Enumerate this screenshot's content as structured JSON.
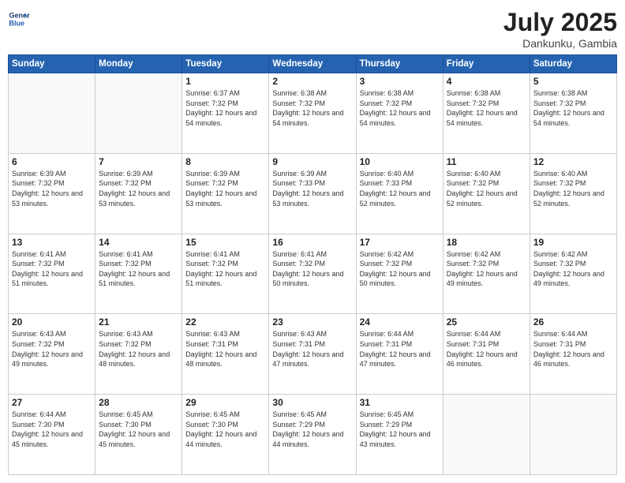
{
  "header": {
    "logo_general": "General",
    "logo_blue": "Blue",
    "month_year": "July 2025",
    "location": "Dankunku, Gambia"
  },
  "days_of_week": [
    "Sunday",
    "Monday",
    "Tuesday",
    "Wednesday",
    "Thursday",
    "Friday",
    "Saturday"
  ],
  "weeks": [
    [
      {
        "day": "",
        "sunrise": "",
        "sunset": "",
        "daylight": ""
      },
      {
        "day": "",
        "sunrise": "",
        "sunset": "",
        "daylight": ""
      },
      {
        "day": "1",
        "sunrise": "Sunrise: 6:37 AM",
        "sunset": "Sunset: 7:32 PM",
        "daylight": "Daylight: 12 hours and 54 minutes."
      },
      {
        "day": "2",
        "sunrise": "Sunrise: 6:38 AM",
        "sunset": "Sunset: 7:32 PM",
        "daylight": "Daylight: 12 hours and 54 minutes."
      },
      {
        "day": "3",
        "sunrise": "Sunrise: 6:38 AM",
        "sunset": "Sunset: 7:32 PM",
        "daylight": "Daylight: 12 hours and 54 minutes."
      },
      {
        "day": "4",
        "sunrise": "Sunrise: 6:38 AM",
        "sunset": "Sunset: 7:32 PM",
        "daylight": "Daylight: 12 hours and 54 minutes."
      },
      {
        "day": "5",
        "sunrise": "Sunrise: 6:38 AM",
        "sunset": "Sunset: 7:32 PM",
        "daylight": "Daylight: 12 hours and 54 minutes."
      }
    ],
    [
      {
        "day": "6",
        "sunrise": "Sunrise: 6:39 AM",
        "sunset": "Sunset: 7:32 PM",
        "daylight": "Daylight: 12 hours and 53 minutes."
      },
      {
        "day": "7",
        "sunrise": "Sunrise: 6:39 AM",
        "sunset": "Sunset: 7:32 PM",
        "daylight": "Daylight: 12 hours and 53 minutes."
      },
      {
        "day": "8",
        "sunrise": "Sunrise: 6:39 AM",
        "sunset": "Sunset: 7:32 PM",
        "daylight": "Daylight: 12 hours and 53 minutes."
      },
      {
        "day": "9",
        "sunrise": "Sunrise: 6:39 AM",
        "sunset": "Sunset: 7:33 PM",
        "daylight": "Daylight: 12 hours and 53 minutes."
      },
      {
        "day": "10",
        "sunrise": "Sunrise: 6:40 AM",
        "sunset": "Sunset: 7:33 PM",
        "daylight": "Daylight: 12 hours and 52 minutes."
      },
      {
        "day": "11",
        "sunrise": "Sunrise: 6:40 AM",
        "sunset": "Sunset: 7:32 PM",
        "daylight": "Daylight: 12 hours and 52 minutes."
      },
      {
        "day": "12",
        "sunrise": "Sunrise: 6:40 AM",
        "sunset": "Sunset: 7:32 PM",
        "daylight": "Daylight: 12 hours and 52 minutes."
      }
    ],
    [
      {
        "day": "13",
        "sunrise": "Sunrise: 6:41 AM",
        "sunset": "Sunset: 7:32 PM",
        "daylight": "Daylight: 12 hours and 51 minutes."
      },
      {
        "day": "14",
        "sunrise": "Sunrise: 6:41 AM",
        "sunset": "Sunset: 7:32 PM",
        "daylight": "Daylight: 12 hours and 51 minutes."
      },
      {
        "day": "15",
        "sunrise": "Sunrise: 6:41 AM",
        "sunset": "Sunset: 7:32 PM",
        "daylight": "Daylight: 12 hours and 51 minutes."
      },
      {
        "day": "16",
        "sunrise": "Sunrise: 6:41 AM",
        "sunset": "Sunset: 7:32 PM",
        "daylight": "Daylight: 12 hours and 50 minutes."
      },
      {
        "day": "17",
        "sunrise": "Sunrise: 6:42 AM",
        "sunset": "Sunset: 7:32 PM",
        "daylight": "Daylight: 12 hours and 50 minutes."
      },
      {
        "day": "18",
        "sunrise": "Sunrise: 6:42 AM",
        "sunset": "Sunset: 7:32 PM",
        "daylight": "Daylight: 12 hours and 49 minutes."
      },
      {
        "day": "19",
        "sunrise": "Sunrise: 6:42 AM",
        "sunset": "Sunset: 7:32 PM",
        "daylight": "Daylight: 12 hours and 49 minutes."
      }
    ],
    [
      {
        "day": "20",
        "sunrise": "Sunrise: 6:43 AM",
        "sunset": "Sunset: 7:32 PM",
        "daylight": "Daylight: 12 hours and 49 minutes."
      },
      {
        "day": "21",
        "sunrise": "Sunrise: 6:43 AM",
        "sunset": "Sunset: 7:32 PM",
        "daylight": "Daylight: 12 hours and 48 minutes."
      },
      {
        "day": "22",
        "sunrise": "Sunrise: 6:43 AM",
        "sunset": "Sunset: 7:31 PM",
        "daylight": "Daylight: 12 hours and 48 minutes."
      },
      {
        "day": "23",
        "sunrise": "Sunrise: 6:43 AM",
        "sunset": "Sunset: 7:31 PM",
        "daylight": "Daylight: 12 hours and 47 minutes."
      },
      {
        "day": "24",
        "sunrise": "Sunrise: 6:44 AM",
        "sunset": "Sunset: 7:31 PM",
        "daylight": "Daylight: 12 hours and 47 minutes."
      },
      {
        "day": "25",
        "sunrise": "Sunrise: 6:44 AM",
        "sunset": "Sunset: 7:31 PM",
        "daylight": "Daylight: 12 hours and 46 minutes."
      },
      {
        "day": "26",
        "sunrise": "Sunrise: 6:44 AM",
        "sunset": "Sunset: 7:31 PM",
        "daylight": "Daylight: 12 hours and 46 minutes."
      }
    ],
    [
      {
        "day": "27",
        "sunrise": "Sunrise: 6:44 AM",
        "sunset": "Sunset: 7:30 PM",
        "daylight": "Daylight: 12 hours and 45 minutes."
      },
      {
        "day": "28",
        "sunrise": "Sunrise: 6:45 AM",
        "sunset": "Sunset: 7:30 PM",
        "daylight": "Daylight: 12 hours and 45 minutes."
      },
      {
        "day": "29",
        "sunrise": "Sunrise: 6:45 AM",
        "sunset": "Sunset: 7:30 PM",
        "daylight": "Daylight: 12 hours and 44 minutes."
      },
      {
        "day": "30",
        "sunrise": "Sunrise: 6:45 AM",
        "sunset": "Sunset: 7:29 PM",
        "daylight": "Daylight: 12 hours and 44 minutes."
      },
      {
        "day": "31",
        "sunrise": "Sunrise: 6:45 AM",
        "sunset": "Sunset: 7:29 PM",
        "daylight": "Daylight: 12 hours and 43 minutes."
      },
      {
        "day": "",
        "sunrise": "",
        "sunset": "",
        "daylight": ""
      },
      {
        "day": "",
        "sunrise": "",
        "sunset": "",
        "daylight": ""
      }
    ]
  ]
}
